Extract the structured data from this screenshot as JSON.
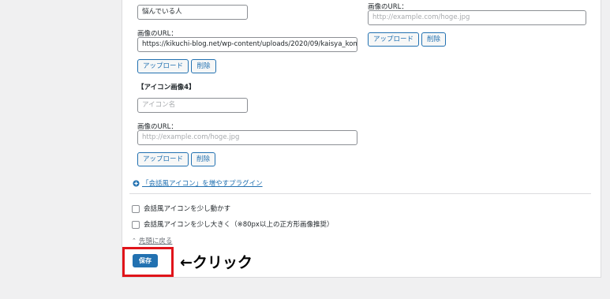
{
  "col1": {
    "name_value": "悩んでいる人",
    "url_label": "画像のURL：",
    "url_value": "https://kikuchi-blog.net/wp-content/uploads/2020/09/kaisya_kom",
    "upload_label": "アップロード",
    "delete_label": "削除"
  },
  "col2": {
    "url_label": "画像のURL：",
    "url_placeholder": "http://example.com/hoge.jpg",
    "upload_label": "アップロード",
    "delete_label": "削除"
  },
  "icon4": {
    "heading": "【アイコン画像4】",
    "name_placeholder": "アイコン名",
    "url_label": "画像のURL：",
    "url_placeholder": "http://example.com/hoge.jpg",
    "upload_label": "アップロード",
    "delete_label": "削除"
  },
  "plugin_link": "「会話風アイコン」を増やすプラグイン",
  "options": [
    {
      "label": "会話風アイコンを少し動かす",
      "checked": false
    },
    {
      "label": "会話風アイコンを少し大きく（※80px以上の正方形画像推奨）",
      "checked": false
    }
  ],
  "back_to_top": "先頭に戻る",
  "save_label": "保存",
  "annotation": "←クリック",
  "colors": {
    "accent": "#2271b1",
    "highlight": "#e0141a"
  }
}
